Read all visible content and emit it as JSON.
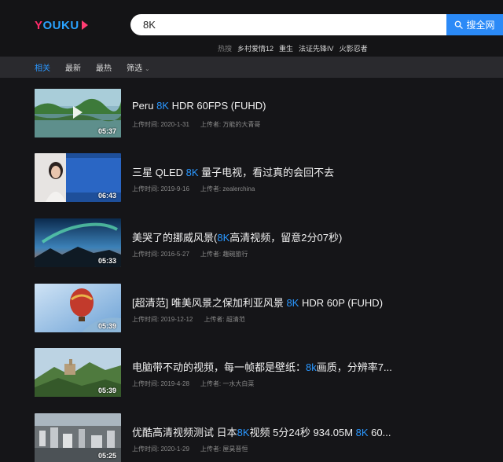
{
  "header": {
    "logo_text": "YOUKU",
    "search_value": "8K",
    "search_button": "搜全网",
    "hot_label": "热搜",
    "hot_terms": [
      "乡村爱情12",
      "重生",
      "法证先锋IV",
      "火影忍者"
    ]
  },
  "filters": {
    "tabs": [
      "相关",
      "最新",
      "最热"
    ],
    "filter_label": "筛选",
    "active": "相关"
  },
  "results": [
    {
      "title_parts": [
        "Peru ",
        "8K",
        " HDR 60FPS (FUHD)"
      ],
      "upload_time": "上传时间: 2020-1-31",
      "uploader": "上传者: 万能的大青哥",
      "duration": "05:37",
      "thumb": "peru"
    },
    {
      "title_parts": [
        "三星 QLED ",
        "8K",
        " 量子电视，看过真的会回不去"
      ],
      "upload_time": "上传时间: 2019-9-16",
      "uploader": "上传者: zealerchina",
      "duration": "06:43",
      "thumb": "tv"
    },
    {
      "title_parts": [
        "美哭了的挪威风景(",
        "8K",
        "高清视频，留意2分07秒)"
      ],
      "upload_time": "上传时间: 2016-5-27",
      "uploader": "上传者: 趣碗旅行",
      "duration": "05:33",
      "thumb": "aurora"
    },
    {
      "title_parts": [
        "[超清范] 唯美风景之保加利亚风景 ",
        "8K",
        " HDR 60P (FUHD)"
      ],
      "upload_time": "上传时间: 2019-12-12",
      "uploader": "上传者: 超清范",
      "duration": "05:39",
      "thumb": "balloon"
    },
    {
      "title_parts": [
        "电脑带不动的视频，每一帧都是壁纸：",
        "8k",
        "画质，分辨率7..."
      ],
      "upload_time": "上传时间: 2019-4-28",
      "uploader": "上传者: 一水大白菜",
      "duration": "05:39",
      "thumb": "castle"
    },
    {
      "title_parts": [
        "优酷高清视频测试 日本",
        "8K",
        "视频 5分24秒 934.05M ",
        "8K",
        " 60..."
      ],
      "upload_time": "上传时间: 2020-1-29",
      "uploader": "上传者: 屋昊晋恒",
      "duration": "05:25",
      "thumb": "city"
    }
  ],
  "colors": {
    "accent": "#2a97ff",
    "search_button": "#2b8af7",
    "background": "#151518",
    "filter_bar": "#2a2a2e"
  }
}
